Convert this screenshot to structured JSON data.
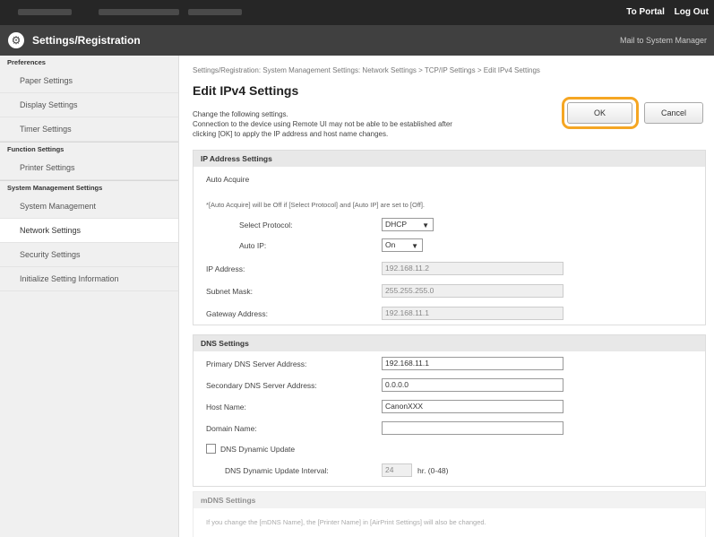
{
  "topbar": {
    "portal": "To Portal",
    "logout": "Log Out"
  },
  "titlebar": {
    "title": "Settings/Registration",
    "mail": "Mail to System Manager"
  },
  "sidebar": {
    "groups": [
      {
        "heading": "Preferences",
        "items": [
          "Paper Settings",
          "Display Settings",
          "Timer Settings"
        ]
      },
      {
        "heading": "Function Settings",
        "items": [
          "Printer Settings"
        ]
      },
      {
        "heading": "System Management Settings",
        "items": [
          "System Management",
          "Network Settings",
          "Security Settings",
          "Initialize Setting Information"
        ]
      }
    ],
    "active": "Network Settings"
  },
  "main": {
    "breadcrumb": "Settings/Registration: System Management Settings: Network Settings > TCP/IP Settings > Edit IPv4 Settings",
    "title": "Edit IPv4 Settings",
    "intro1": "Change the following settings.",
    "intro2": "Connection to the device using Remote UI may not be able to be established after",
    "intro3": "clicking [OK] to apply the IP address and host name changes.",
    "ok": "OK",
    "cancel": "Cancel"
  },
  "ip": {
    "heading": "IP Address Settings",
    "auto_acquire": "Auto Acquire",
    "note": "*[Auto Acquire] will be Off if [Select Protocol] and [Auto IP] are set to [Off].",
    "select_protocol_label": "Select Protocol:",
    "select_protocol_value": "DHCP",
    "auto_ip_label": "Auto IP:",
    "auto_ip_value": "On",
    "ip_address_label": "IP Address:",
    "ip_address_value": "192.168.11.2",
    "subnet_label": "Subnet Mask:",
    "subnet_value": "255.255.255.0",
    "gateway_label": "Gateway Address:",
    "gateway_value": "192.168.11.1"
  },
  "dns": {
    "heading": "DNS Settings",
    "primary_label": "Primary DNS Server Address:",
    "primary_value": "192.168.11.1",
    "secondary_label": "Secondary DNS Server Address:",
    "secondary_value": "0.0.0.0",
    "host_label": "Host Name:",
    "host_value": "CanonXXX",
    "domain_label": "Domain Name:",
    "domain_value": "",
    "dynamic_label": "DNS Dynamic Update",
    "interval_label": "DNS Dynamic Update Interval:",
    "interval_value": "24",
    "interval_unit": "hr. (0-48)"
  },
  "mdns": {
    "heading": "mDNS Settings",
    "note": "If you change the [mDNS Name], the [Printer Name] in [AirPrint Settings] will also be changed."
  }
}
